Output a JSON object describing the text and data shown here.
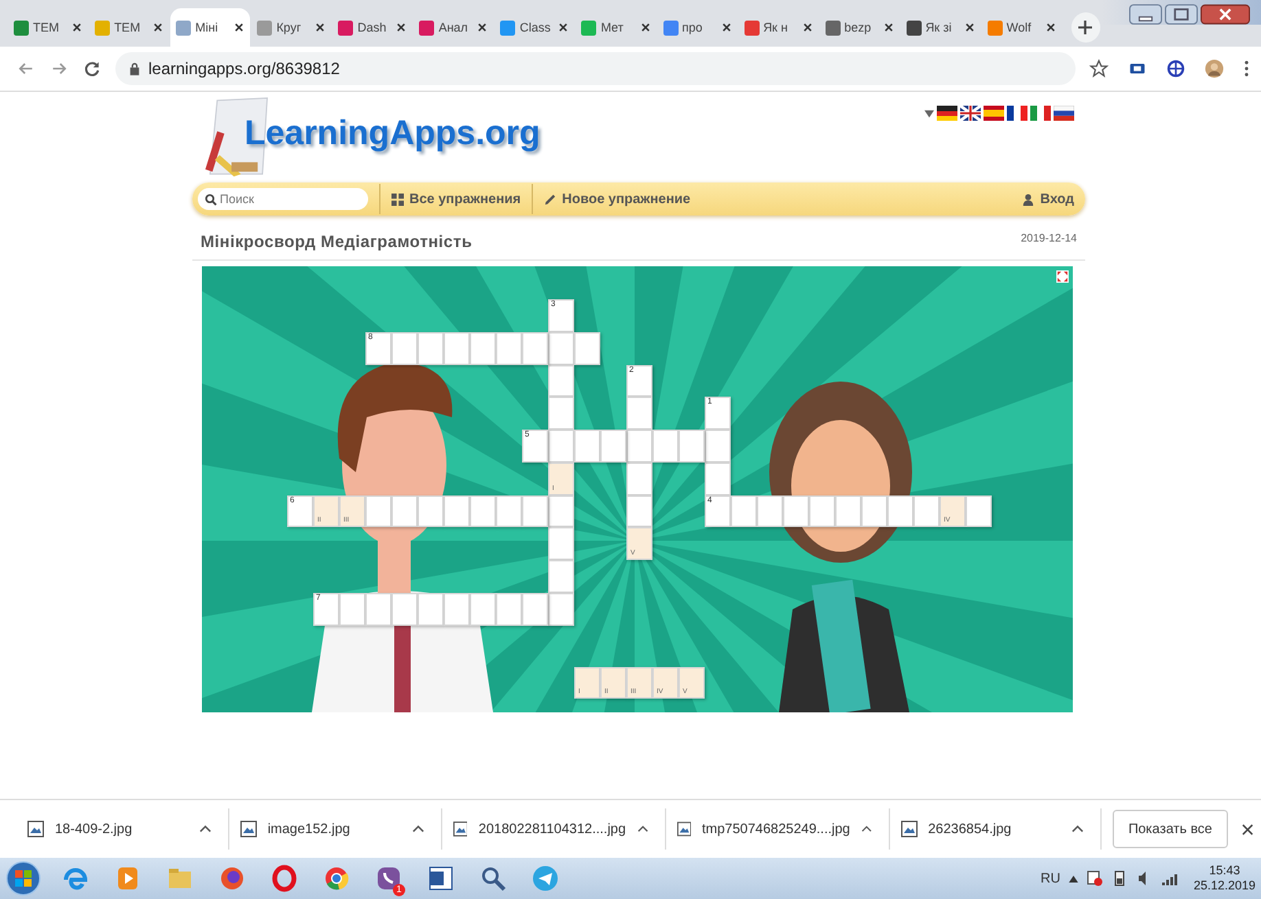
{
  "browser": {
    "tabs": [
      {
        "title": "TEM",
        "color": "#1e8e3e",
        "selected": false
      },
      {
        "title": "TEM",
        "color": "#e3b100",
        "selected": false
      },
      {
        "title": "Міні",
        "color": "#8fa8c8",
        "selected": true
      },
      {
        "title": "Круг",
        "color": "#9a9a9a",
        "selected": false
      },
      {
        "title": "Dash",
        "color": "#d81b60",
        "selected": false
      },
      {
        "title": "Анал",
        "color": "#d81b60",
        "selected": false
      },
      {
        "title": "Class",
        "color": "#2196f3",
        "selected": false
      },
      {
        "title": "Мет",
        "color": "#1db954",
        "selected": false
      },
      {
        "title": "про",
        "color": "#4285f4",
        "selected": false
      },
      {
        "title": "Як н",
        "color": "#e53935",
        "selected": false
      },
      {
        "title": "bezp",
        "color": "#666666",
        "selected": false
      },
      {
        "title": "Як зі",
        "color": "#444444",
        "selected": false
      },
      {
        "title": "Wolf",
        "color": "#f57c00",
        "selected": false
      }
    ],
    "address": "learningapps.org/8639812"
  },
  "site": {
    "logo": "LearningApps.org",
    "search": {
      "placeholder": "Поиск"
    },
    "nav": [
      {
        "label": "Все упражнения",
        "kind": "grid"
      },
      {
        "label": "Новое упражнение",
        "kind": "pencil"
      }
    ],
    "login": "Вход",
    "title": "Мінікросворд Медіаграмотність",
    "date": "2019-12-14"
  },
  "crossword": {
    "clues": [
      {
        "number": "1",
        "cells": [
          {
            "highlighted": false
          },
          {
            "highlighted": false
          },
          {
            "highlighted": false
          },
          {
            "highlighted": false
          }
        ]
      },
      {
        "number": "2",
        "cells": [
          {
            "highlighted": false
          },
          {
            "highlighted": false
          },
          {
            "highlighted": false
          },
          {
            "highlighted": false
          },
          {
            "highlighted": false
          },
          {
            "highlighted": true,
            "mark": "V"
          }
        ]
      },
      {
        "number": "3",
        "cells": [
          {
            "highlighted": false
          },
          {
            "highlighted": false
          },
          {
            "highlighted": false
          },
          {
            "highlighted": false
          },
          {
            "highlighted": false
          },
          {
            "highlighted": true,
            "mark": "I"
          },
          {
            "highlighted": false
          },
          {
            "highlighted": false
          },
          {
            "highlighted": false
          },
          {
            "highlighted": false
          }
        ]
      },
      {
        "number": "4",
        "cells": [
          {
            "highlighted": false
          },
          {
            "highlighted": false
          },
          {
            "highlighted": false
          },
          {
            "highlighted": false
          },
          {
            "highlighted": false
          },
          {
            "highlighted": false
          },
          {
            "highlighted": false
          },
          {
            "highlighted": false
          },
          {
            "highlighted": false
          },
          {
            "highlighted": true,
            "mark": "IV"
          },
          {
            "highlighted": false
          }
        ]
      },
      {
        "number": "5",
        "cells": [
          {
            "highlighted": false
          },
          {
            "highlighted": false
          },
          {
            "highlighted": false
          },
          {
            "highlighted": false
          },
          {
            "highlighted": false
          },
          {
            "highlighted": false
          },
          {
            "highlighted": false
          },
          {
            "highlighted": false
          }
        ]
      },
      {
        "number": "6",
        "cells": [
          {
            "highlighted": false
          },
          {
            "highlighted": true,
            "mark": "II"
          },
          {
            "highlighted": true,
            "mark": "III"
          },
          {
            "highlighted": false
          },
          {
            "highlighted": false
          },
          {
            "highlighted": false
          },
          {
            "highlighted": false
          },
          {
            "highlighted": false
          },
          {
            "highlighted": false
          },
          {
            "highlighted": false
          },
          {
            "highlighted": false
          }
        ]
      },
      {
        "number": "7",
        "cells": [
          {
            "highlighted": false
          },
          {
            "highlighted": false
          },
          {
            "highlighted": false
          },
          {
            "highlighted": false
          },
          {
            "highlighted": false
          },
          {
            "highlighted": false
          },
          {
            "highlighted": false
          },
          {
            "highlighted": false
          },
          {
            "highlighted": false
          },
          {
            "highlighted": false
          }
        ]
      },
      {
        "number": "8",
        "cells": [
          {
            "highlighted": false
          },
          {
            "highlighted": false
          },
          {
            "highlighted": false
          },
          {
            "highlighted": false
          },
          {
            "highlighted": false
          },
          {
            "highlighted": false
          },
          {
            "highlighted": false
          },
          {
            "highlighted": false
          },
          {
            "highlighted": false
          }
        ]
      }
    ],
    "solution": [
      {
        "mark": "I"
      },
      {
        "mark": "II"
      },
      {
        "mark": "III"
      },
      {
        "mark": "IV"
      },
      {
        "mark": "V"
      }
    ]
  },
  "downloads": {
    "files": [
      "18-409-2.jpg",
      "image152.jpg",
      "201802281104312....jpg",
      "tmp750746825249....jpg",
      "26236854.jpg"
    ],
    "show_all": "Показать все"
  },
  "taskbar": {
    "badge": "1",
    "language": "RU",
    "time": "15:43",
    "date": "25.12.2019"
  }
}
